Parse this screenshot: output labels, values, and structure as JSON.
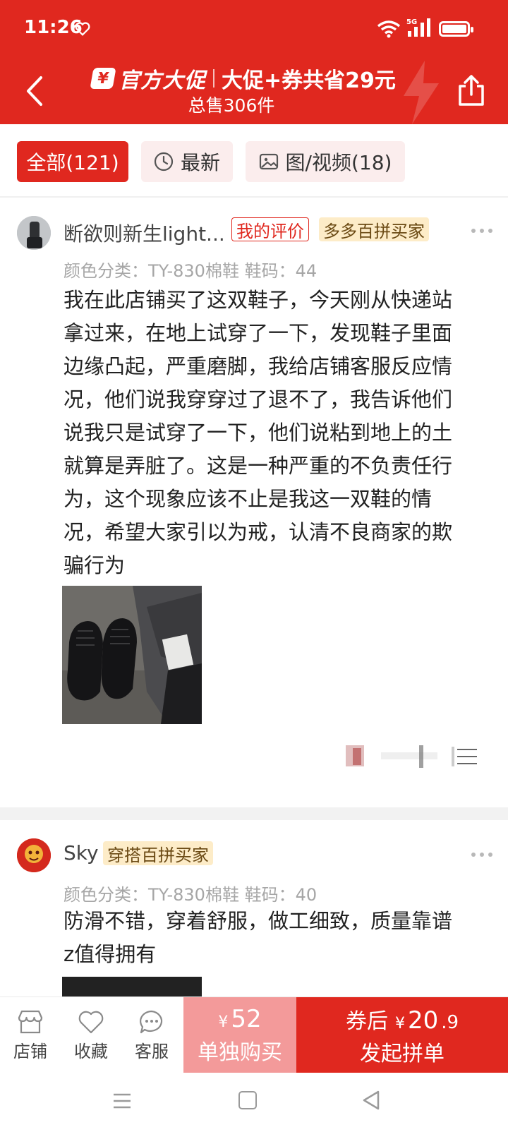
{
  "status_bar": {
    "time": "11:26",
    "network": "5G"
  },
  "header": {
    "promo_yen": "¥",
    "promo_official": "官方大促",
    "promo_save": "大促+券共省29元",
    "total_sold": "总售306件"
  },
  "tabs": [
    {
      "label": "全部(121)",
      "active": true
    },
    {
      "label": "最新",
      "icon": "clock-icon"
    },
    {
      "label": "图/视频(18)",
      "icon": "image-icon"
    }
  ],
  "reviews": [
    {
      "username": "断欲则新生light...",
      "mine_tag": "我的评价",
      "buyer_tag": "多多百拼买家",
      "spec": "颜色分类：TY-830棉鞋  鞋码：44",
      "content_lines": [
        "我在此店铺买了这双鞋子，今天刚从快递站",
        "拿过来，在地上试穿了一下，发现鞋子里面",
        "边缘凸起，严重磨脚，我给店铺客服反应情",
        "况，他们说我穿穿过了退不了，我告诉他们",
        "说我只是试穿了一下，他们说粘到地上的土",
        "就算是弄脏了。这是一种严重的不负责任行",
        "为，这个现象应该不止是我这一双鞋的情",
        "况，希望大家引以为戒，认清不良商家的欺",
        "骗行为"
      ]
    },
    {
      "username": "Sky",
      "buyer_tag": "穿搭百拼买家",
      "spec": "颜色分类：TY-830棉鞋  鞋码：40",
      "content_lines": [
        "防滑不错，穿着舒服，做工细致，质量靠谱",
        "z值得拥有"
      ]
    }
  ],
  "bottom_bar": {
    "store": "店铺",
    "favorite": "收藏",
    "service": "客服",
    "single_yen": "¥",
    "single_price": "52",
    "single_label": "单独购买",
    "coupon_prefix": "券后",
    "group_yen": "¥",
    "group_price_int": "20",
    "group_price_dec": ".9",
    "group_label": "发起拼单"
  },
  "colors": {
    "brand_red": "#e0281f",
    "single_buy_pink": "#f39a9a",
    "buyer_tag_bg": "#fdecc8"
  }
}
